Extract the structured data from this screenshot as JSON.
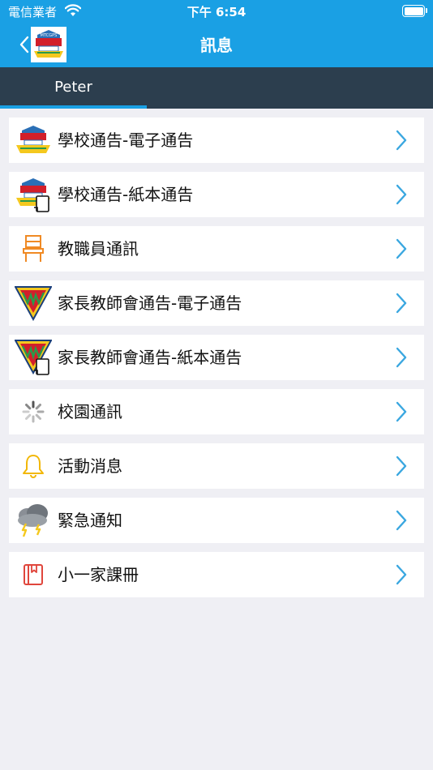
{
  "status_bar": {
    "carrier": "電信業者",
    "time": "下午 6:54",
    "battery_level": 1.0
  },
  "nav": {
    "title": "訊息",
    "back_icon": "chevron-left-icon",
    "logo_text": "MTCGPS"
  },
  "tabs": [
    {
      "label": "Peter",
      "selected": true
    }
  ],
  "colors": {
    "accent": "#1aa0e4",
    "tabbar": "#2c3e4e",
    "background": "#efeff4",
    "chevron": "#3aa7e0"
  },
  "messages": {
    "items": [
      {
        "label": "學校通告-電子通告",
        "icon": "school-badge-icon"
      },
      {
        "label": "學校通告-紙本通告",
        "icon": "school-badge-paper-icon"
      },
      {
        "label": "教職員通訊",
        "icon": "chair-icon"
      },
      {
        "label": "家長教師會通告-電子通告",
        "icon": "pta-logo-icon"
      },
      {
        "label": "家長教師會通告-紙本通告",
        "icon": "pta-logo-paper-icon"
      },
      {
        "label": "校園通訊",
        "icon": "spinner-icon"
      },
      {
        "label": "活動消息",
        "icon": "bell-icon"
      },
      {
        "label": "緊急通知",
        "icon": "storm-cloud-icon"
      },
      {
        "label": "小一家課冊",
        "icon": "book-icon"
      }
    ]
  }
}
